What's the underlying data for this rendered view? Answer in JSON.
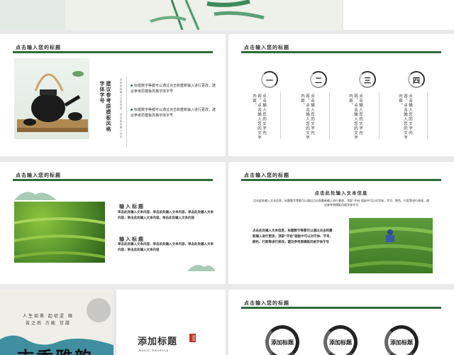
{
  "slides": {
    "s2": {
      "title": "点击输入您的标题",
      "vtext1": "建议参考原模板风格",
      "vtext2": "字体字号",
      "vsmall": "点击此处输入文本内容，点击此处输入文本",
      "bullet1": "标题数字等都可以通过点击和重新输入进行更改，建议参考原模板风格字体字号",
      "bullet2": "标题数字等都可以通过点击和重新输入进行更改，建议参考原模板风格字体字号"
    },
    "s3": {
      "title": "点击输入您的标题",
      "nums": [
        "一",
        "二",
        "三",
        "四"
      ],
      "col_text": "点击输入您的文字内容，点击输入您的文字内容。"
    },
    "s4": {
      "title": "点击输入您的标题",
      "h1": "输入标题",
      "p1": "单击此处输入文本内容，单击此处输入文本内容，单击此处输入文本内容，单击此处输入文本内容，单击此处输入文本内容",
      "h2": "输入标题",
      "p2": "单击此处输入文本内容，单击此处输入文本内容，单击此处输入文本内容，单击此处输入文本内容"
    },
    "s5": {
      "title": "点击输入您的标题",
      "heading": "点击此处输入文本信息",
      "intro": "点击此处输入文本信息，标题数字等都可以通过点击和重新输入进行更改，顶部“开始”面板中可以对字体、字号、颜色、行距等进行修改，建议参考原模板风格字体字号",
      "body": "点击此处输入文本信息，标题数字等都可以通过点击和重新输入进行更改，顶部“开始”面板中可以对字体、字号、颜色、行距等进行修改，建议参考原模板风格字体字号"
    },
    "s6": {
      "poem1": "人生如茶 起初涩 微",
      "poem2": "苦之后 方能 甘甜",
      "big": "古香雅韵"
    },
    "s7": {
      "title": "添加标题",
      "sub": "BASIC PROFILE",
      "seal": "添加"
    },
    "s8": {
      "title": "点击输入您的标题",
      "labels": [
        "添加标题",
        "添加标题",
        "添加标题"
      ]
    }
  },
  "colors": {
    "accent": "#2f6b3a",
    "tea_green": "#4f8a2a"
  }
}
